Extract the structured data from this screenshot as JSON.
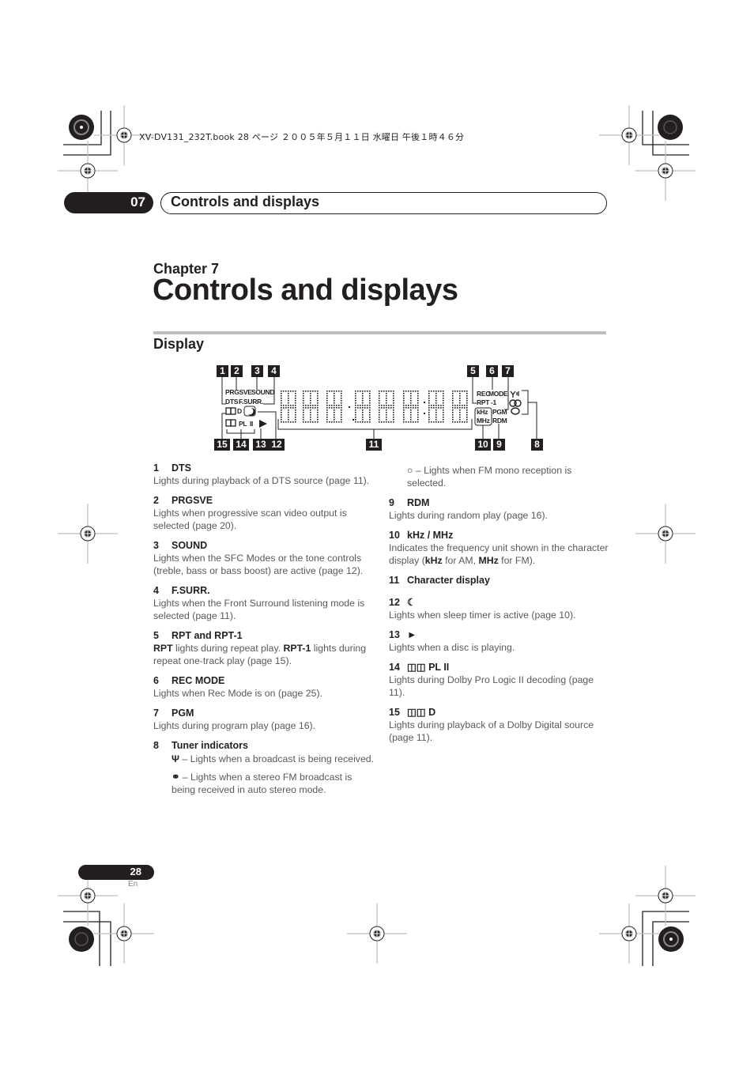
{
  "print_header": "XV-DV131_232T.book  28 ページ  ２００５年５月１１日  水曜日  午後１時４６分",
  "chapter_tab": {
    "number": "07",
    "title": "Controls and displays"
  },
  "chapter_label": "Chapter 7",
  "page_title": "Controls and displays",
  "section_title": "Display",
  "diagram": {
    "callouts": [
      "1",
      "2",
      "3",
      "4",
      "5",
      "6",
      "7",
      "8",
      "9",
      "10",
      "11",
      "12",
      "13",
      "14",
      "15"
    ],
    "lcd_labels": {
      "prgsve": "PRGSVE",
      "sound": "SOUND",
      "dts": "DTS",
      "fsurr": "F.SURR.",
      "dolby_d": "D",
      "pl": "PL",
      "pl_ii": "II",
      "rec": "REC",
      "mode": "MODE",
      "rpt": "RPT",
      "rpt1": "-1",
      "khz": "kHz",
      "mhz": "MHz",
      "pgm": "PGM",
      "rdm": "RDM"
    },
    "icons": [
      "dolby-icon",
      "sleep-icon",
      "play-icon",
      "antenna-icon",
      "stereo-icon",
      "mono-icon"
    ]
  },
  "left_items": [
    {
      "num": "1",
      "title": "DTS",
      "body": "Lights during playback of a DTS source (page 11)."
    },
    {
      "num": "2",
      "title": "PRGSVE",
      "body": "Lights when progressive scan video output is selected (page 20)."
    },
    {
      "num": "3",
      "title": "SOUND",
      "body": "Lights when the SFC Modes or the tone controls (treble, bass or bass boost) are active (page 12)."
    },
    {
      "num": "4",
      "title": "F.SURR.",
      "body": "Lights when the Front Surround listening mode is selected (page 11)."
    },
    {
      "num": "5",
      "title": "RPT and RPT-1",
      "body_parts": [
        "RPT",
        " lights during repeat play. ",
        "RPT-1",
        " lights during repeat one-track play (page 15)."
      ]
    },
    {
      "num": "6",
      "title": "REC MODE",
      "body": "Lights when Rec Mode is on (page 25)."
    },
    {
      "num": "7",
      "title": "PGM",
      "body": "Lights during program play (page 16)."
    },
    {
      "num": "8",
      "title": "Tuner indicators",
      "subs": [
        {
          "icon": "antenna-icon",
          "text": " – Lights when a broadcast is being received."
        },
        {
          "icon": "stereo-icon",
          "text": " – Lights when a stereo FM broadcast is being received in auto stereo mode."
        }
      ]
    }
  ],
  "right_items": [
    {
      "sub": {
        "icon": "mono-icon",
        "text": " – Lights when FM mono reception is selected."
      }
    },
    {
      "num": "9",
      "title": "RDM",
      "body": "Lights during random play (page 16)."
    },
    {
      "num": "10",
      "title": "kHz / MHz",
      "body_parts": [
        "Indicates the frequency unit shown in the character display (",
        "kHz",
        " for AM, ",
        "MHz",
        " for FM)."
      ]
    },
    {
      "num": "11",
      "title": "Character display",
      "body": ""
    },
    {
      "num": "12",
      "title_icon": "sleep-icon",
      "body": "Lights when sleep timer is active (page 10)."
    },
    {
      "num": "13",
      "title_icon": "play-icon",
      "body": "Lights when a disc is playing."
    },
    {
      "num": "14",
      "title": "PL II",
      "title_icon": "dolby-icon",
      "body": "Lights during Dolby Pro Logic II decoding (page 11)."
    },
    {
      "num": "15",
      "title": "D",
      "title_icon": "dolby-icon",
      "body": "Lights during playback of a Dolby Digital source (page 11)."
    }
  ],
  "footer": {
    "page_number": "28",
    "language": "En"
  }
}
